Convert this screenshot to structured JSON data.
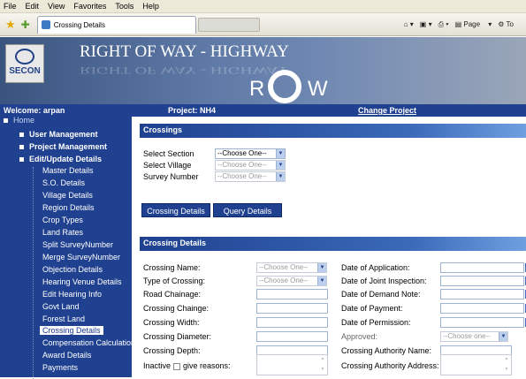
{
  "menu": [
    "File",
    "Edit",
    "View",
    "Favorites",
    "Tools",
    "Help"
  ],
  "browser": {
    "tab_title": "Crossing Details",
    "page_label": "Page",
    "tools_label": "To"
  },
  "banner": {
    "logo_text": "SECON",
    "title": "RIGHT OF WAY - HIGHWAY",
    "row_text": "R",
    "row_text2": "W"
  },
  "info": {
    "welcome": "Welcome: arpan",
    "project": "Project: NH4",
    "change": "Change Project"
  },
  "sidebar": {
    "home": "Home",
    "user_mgmt": "User Management",
    "project_mgmt": "Project Management",
    "edit_update": "Edit/Update Details",
    "items": [
      "Master Details",
      "S.O. Details",
      "Village Details",
      "Region Details",
      "Crop Types",
      "Land Rates",
      "Split SurveyNumber",
      "Merge SurveyNumber",
      "Objection Details",
      "Hearing Venue Details",
      "Edit Hearing Info",
      "Govt Land",
      "Forest Land",
      "Crossing Details",
      "Compensation Calculation",
      "Award Details",
      "Payments"
    ]
  },
  "crossings": {
    "title": "Crossings",
    "select_section": "Select Section",
    "select_village": "Select Village",
    "survey_number": "Survey Number",
    "choose": "--Choose One--",
    "btn_crossing": "Crossing Details",
    "btn_query": "Query Details"
  },
  "details": {
    "title": "Crossing Details",
    "crossing_name": "Crossing Name:",
    "type_of_crossing": "Type of Crossing:",
    "road_chainage": "Road Chainage:",
    "crossing_chainge": "Crossing Chainge:",
    "crossing_width": "Crossing Width:",
    "crossing_diameter": "Crossing Diameter:",
    "crossing_depth": "Crossing Depth:",
    "inactive": "Inactive",
    "give_reasons": "give reasons:",
    "choose": "--Choose One--",
    "date_application": "Date of Application:",
    "date_joint": "Date of Joint Inspection:",
    "date_demand": "Date of Demand Note:",
    "date_payment": "Date of Payment:",
    "date_permission": "Date of Permission:",
    "approved": "Approved:",
    "choose_lower": "--Choose one--",
    "authority_name": "Crossing Authority Name:",
    "authority_address": "Crossing Authority Address:"
  }
}
